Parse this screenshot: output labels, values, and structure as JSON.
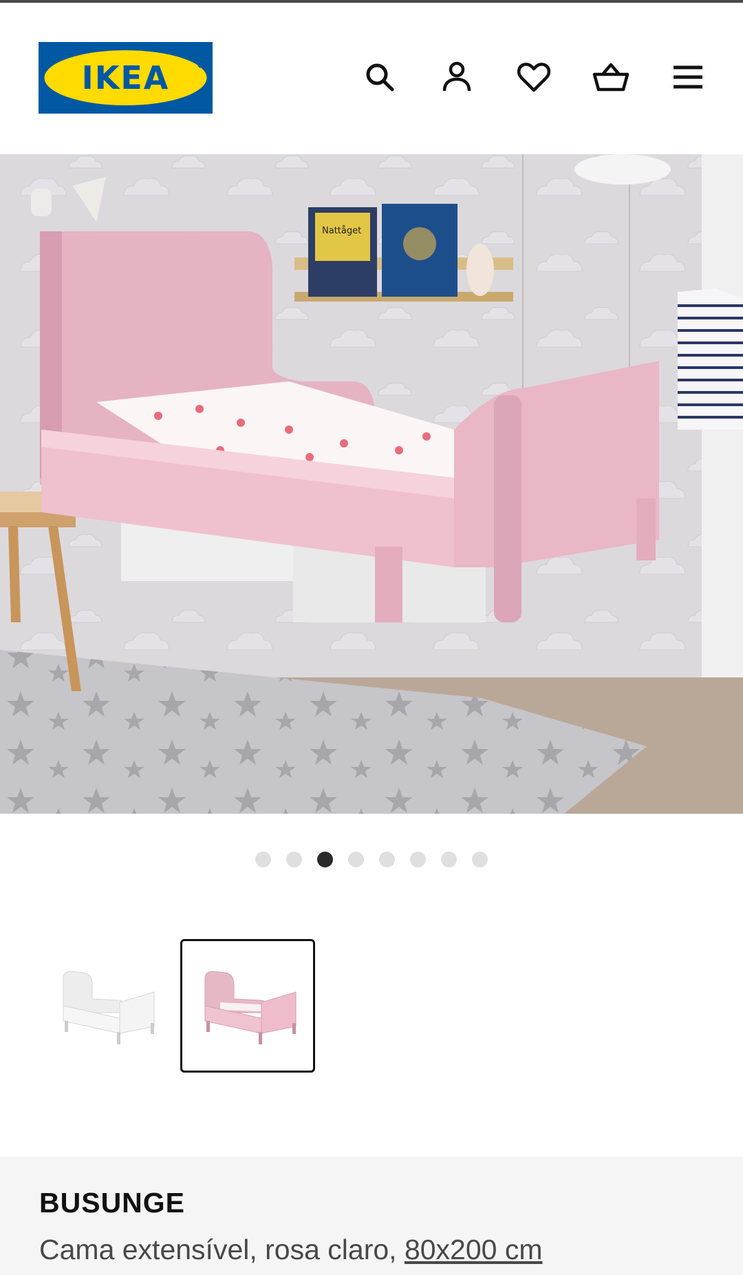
{
  "header": {
    "logo_text": "IKEA",
    "colors": {
      "logo_blue": "#0058A3",
      "logo_yellow": "#FFDB00"
    },
    "icons": [
      "search-icon",
      "account-icon",
      "favourites-icon",
      "basket-icon",
      "menu-icon"
    ]
  },
  "gallery": {
    "image_count": 8,
    "active_index": 2,
    "thumbnails": [
      {
        "variant": "white",
        "selected": false
      },
      {
        "variant": "light-pink",
        "selected": true
      }
    ]
  },
  "product": {
    "name": "BUSUNGE",
    "description": "Cama extensível, rosa claro, ",
    "size": "80x200 cm"
  },
  "hero_book_title": "Nattåget"
}
